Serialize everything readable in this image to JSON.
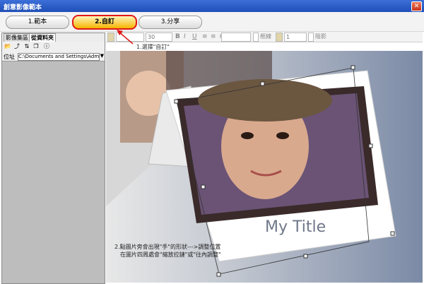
{
  "window": {
    "title": "創意影像範本",
    "close": "✕"
  },
  "steps": [
    {
      "label": "1.範本"
    },
    {
      "label": "2.自訂"
    },
    {
      "label": "3.分享"
    }
  ],
  "left_panel": {
    "tabs": [
      "影像集區",
      "從資料夾"
    ],
    "path_label": "位址",
    "path_value": "C:\\Documents and Settings\\Administrato"
  },
  "format_bar": {
    "font_size": "30",
    "bold": "B",
    "italic": "I",
    "underline": "U",
    "border_label": "框線",
    "shadow_label": "陰影",
    "spin_value": "1"
  },
  "annotations": {
    "select_custom": "1.選擇\"自訂\"",
    "step2_line1": "2.點圖片旁會出現\"手\"的形狀--->調整位置",
    "step2_line2": "在圖片四周處會\"縮放拉鏈\"或\"往內調整\""
  },
  "card": {
    "title": "My Title"
  },
  "colors": {
    "accent": "#e01818",
    "active_step": "#f5b400",
    "titlebar": "#2a5cc8"
  }
}
